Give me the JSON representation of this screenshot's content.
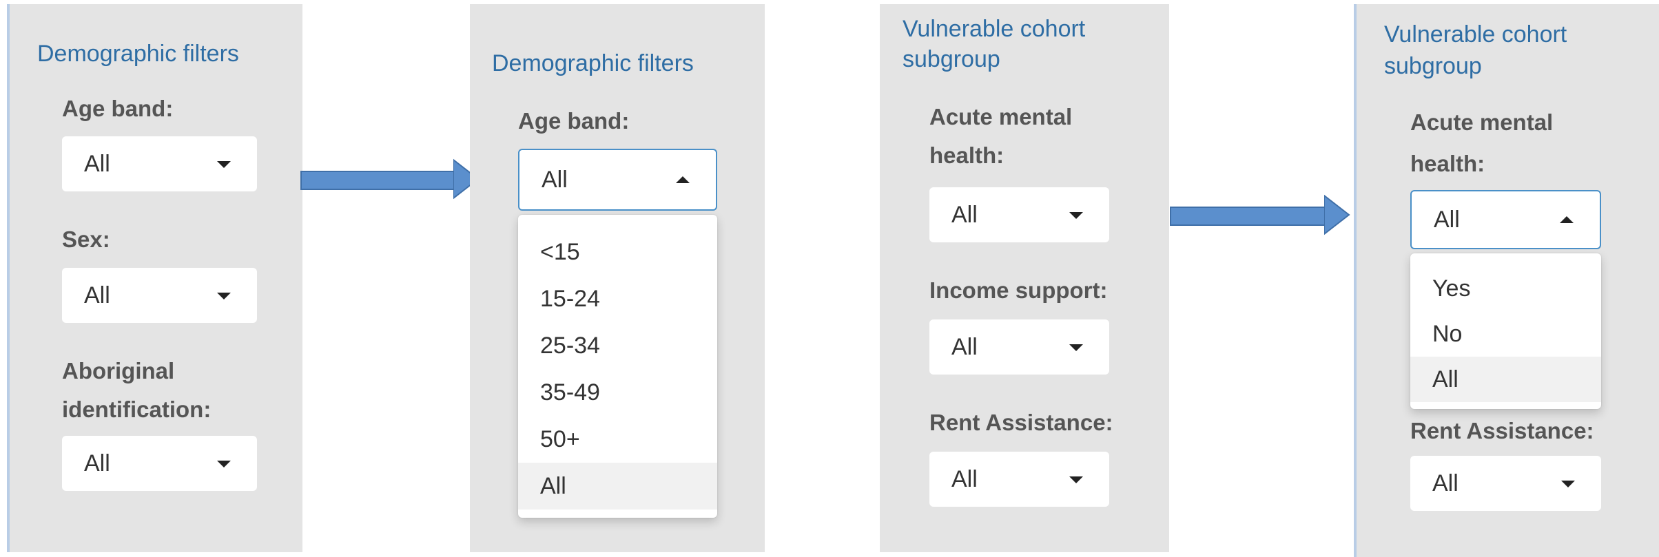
{
  "panels": [
    {
      "title": "Demographic filters",
      "labels": [
        "Age band:",
        "Sex:",
        "Aboriginal",
        "identification:"
      ],
      "selects": [
        "All",
        "All",
        "All"
      ]
    },
    {
      "title": "Demographic filters",
      "labels": [
        "Age band:"
      ],
      "selects": [
        "All"
      ],
      "options": [
        "<15",
        "15-24",
        "25-34",
        "35-49",
        "50+",
        "All"
      ],
      "selected_option": "All"
    },
    {
      "title_lines": [
        "Vulnerable cohort",
        "subgroup"
      ],
      "labels": [
        "Acute mental",
        "health:",
        "Income support:",
        "Rent Assistance:"
      ],
      "selects": [
        "All",
        "All",
        "All"
      ]
    },
    {
      "title_lines": [
        "Vulnerable cohort",
        "subgroup"
      ],
      "labels": [
        "Acute mental",
        "health:",
        "Rent Assistance:"
      ],
      "selects": [
        "All",
        "All"
      ],
      "options": [
        "Yes",
        "No",
        "All"
      ],
      "selected_option": "All"
    }
  ],
  "colors": {
    "title": "#2e6da4",
    "arrow": "#5b8fcd",
    "panel_bg": "#e4e4e4"
  },
  "icons": {
    "closed": "caret-down-icon",
    "open": "caret-up-icon",
    "transition": "right-arrow-icon"
  }
}
